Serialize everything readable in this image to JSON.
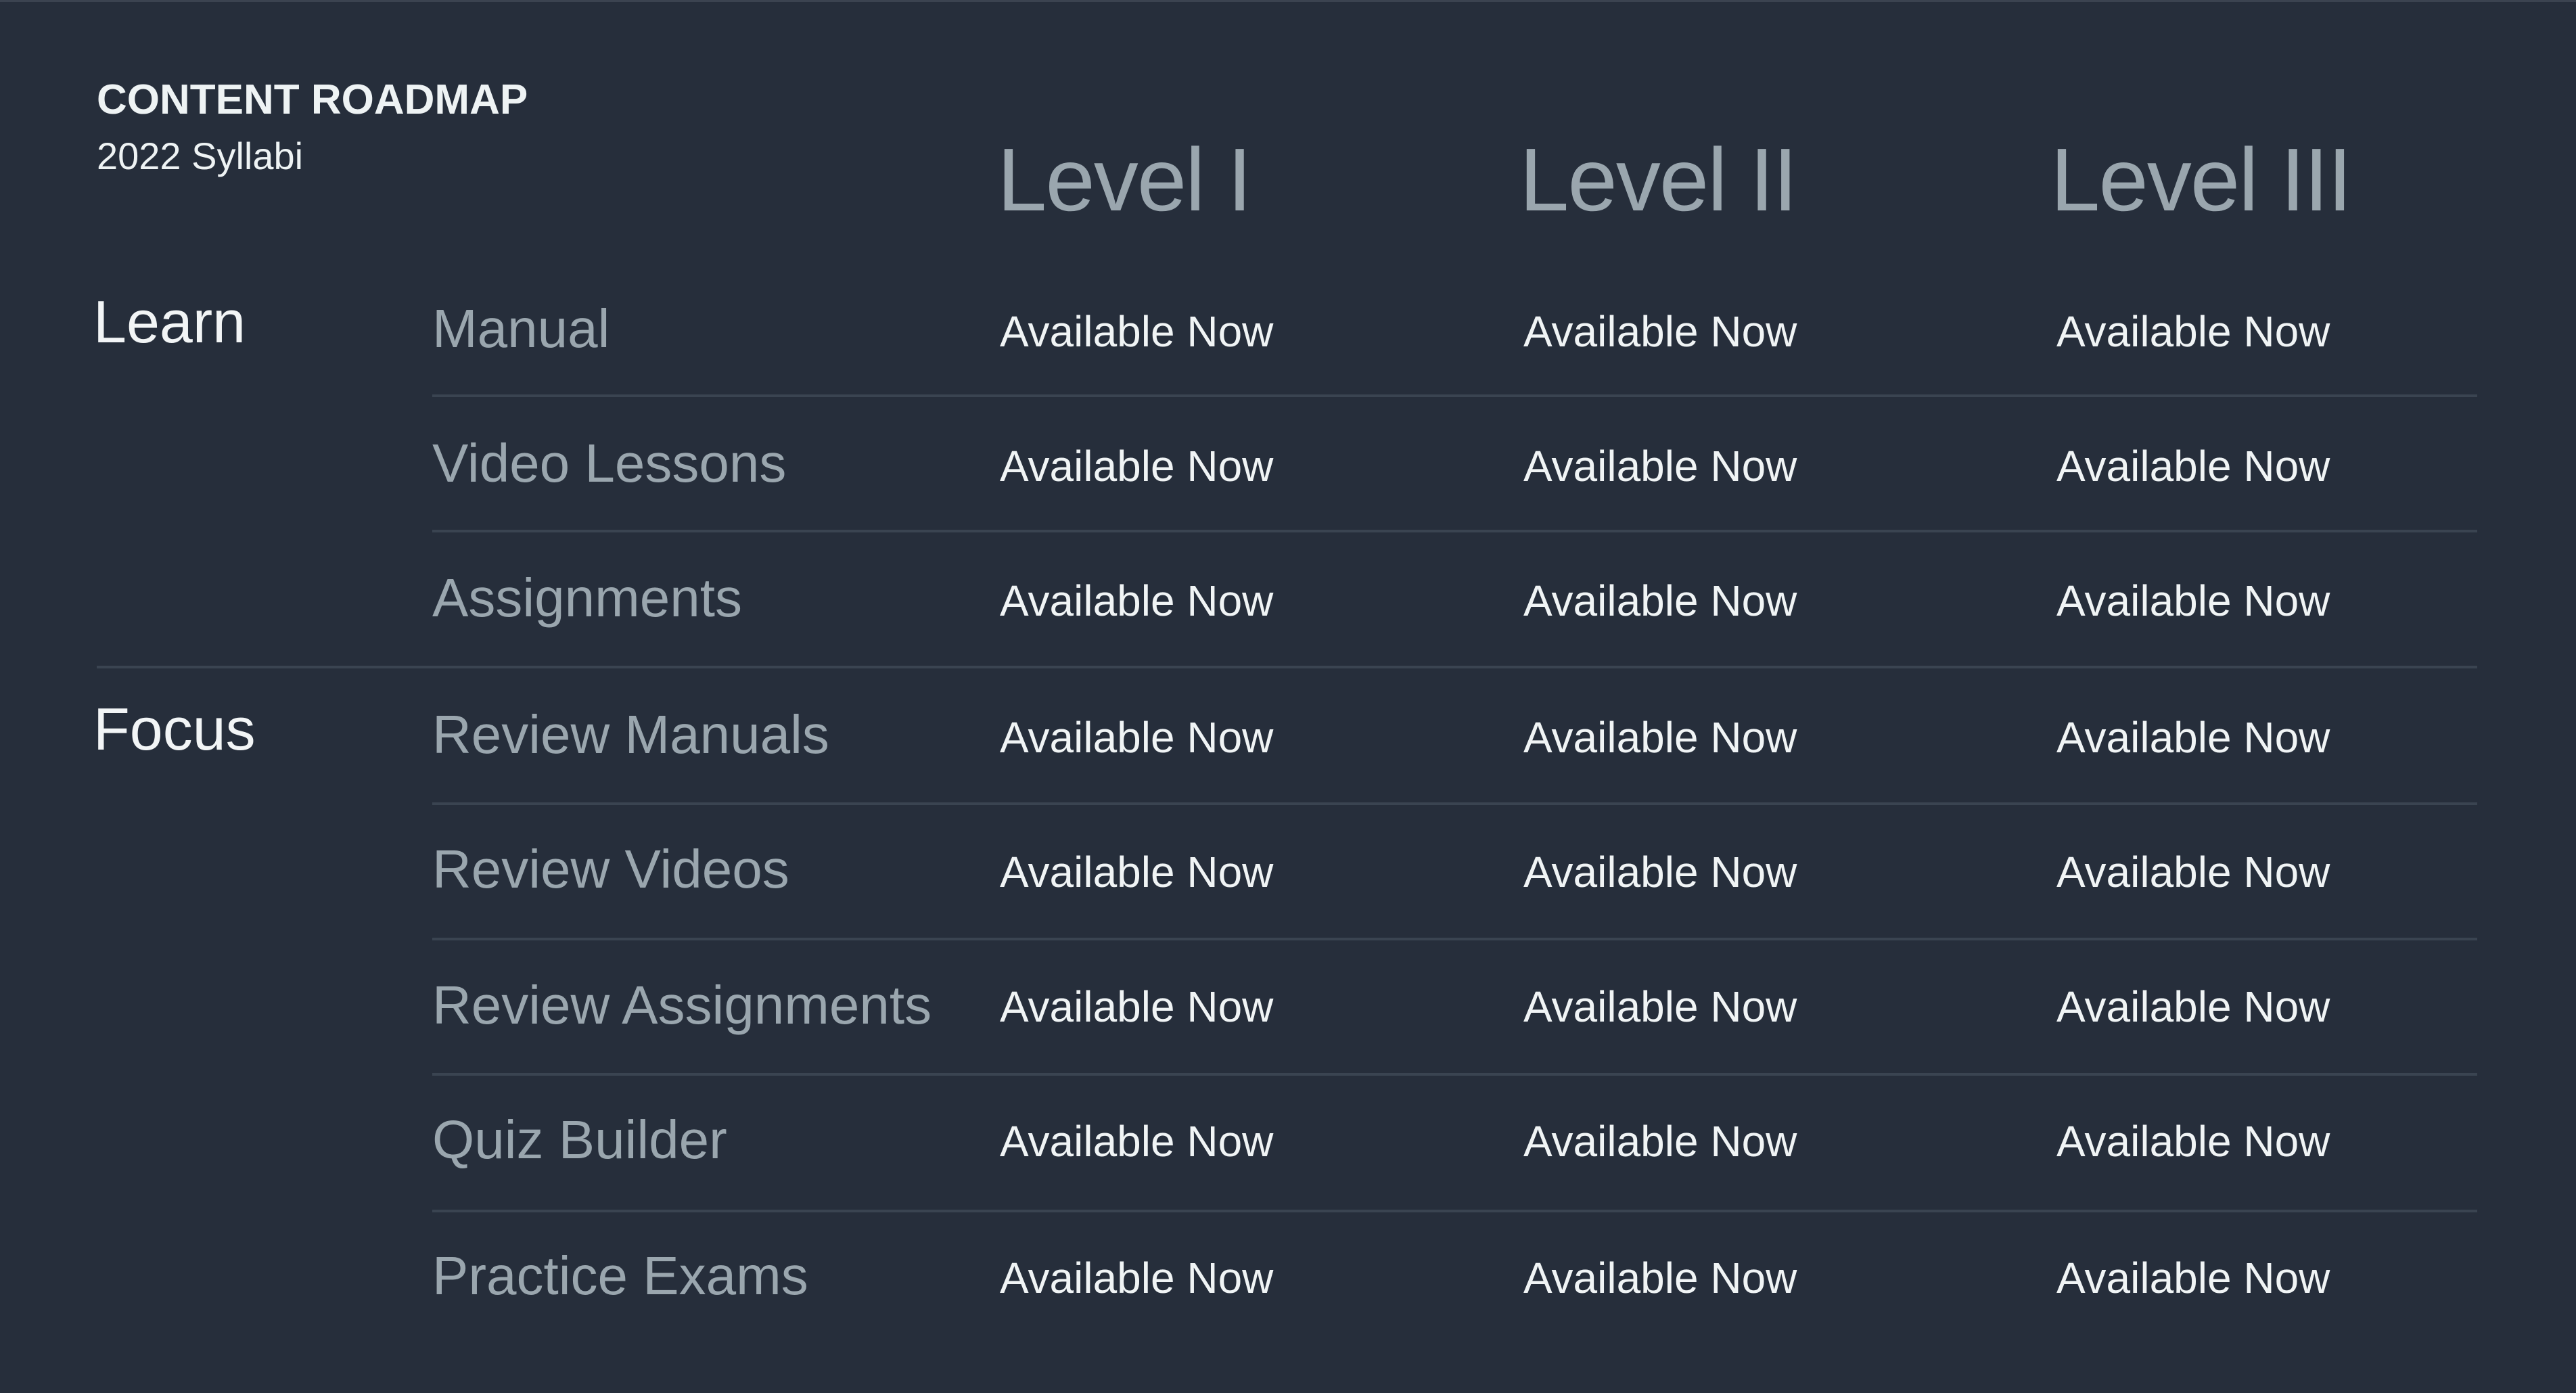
{
  "header": {
    "title": "CONTENT ROADMAP",
    "subtitle": "2022 Syllabi"
  },
  "columns": [
    "Level I",
    "Level II",
    "Level III"
  ],
  "groups": [
    {
      "label": "Learn",
      "rows": [
        {
          "label": "Manual",
          "values": [
            "Available Now",
            "Available Now",
            "Available Now"
          ]
        },
        {
          "label": "Video Lessons",
          "values": [
            "Available Now",
            "Available Now",
            "Available Now"
          ]
        },
        {
          "label": "Assignments",
          "values": [
            "Available Now",
            "Available Now",
            "Available Now"
          ]
        }
      ]
    },
    {
      "label": "Focus",
      "rows": [
        {
          "label": "Review Manuals",
          "values": [
            "Available Now",
            "Available Now",
            "Available Now"
          ]
        },
        {
          "label": "Review Videos",
          "values": [
            "Available Now",
            "Available Now",
            "Available Now"
          ]
        },
        {
          "label": "Review Assignments",
          "values": [
            "Available Now",
            "Available Now",
            "Available Now"
          ]
        },
        {
          "label": "Quiz Builder",
          "values": [
            "Available Now",
            "Available Now",
            "Available Now"
          ]
        },
        {
          "label": "Practice Exams",
          "values": [
            "Available Now",
            "Available Now",
            "Available Now"
          ]
        }
      ]
    }
  ],
  "colors": {
    "background": "#262e3b",
    "heading_text": "#eef3f4",
    "muted_text": "#9aa6ae",
    "divider": "#3a4451"
  }
}
